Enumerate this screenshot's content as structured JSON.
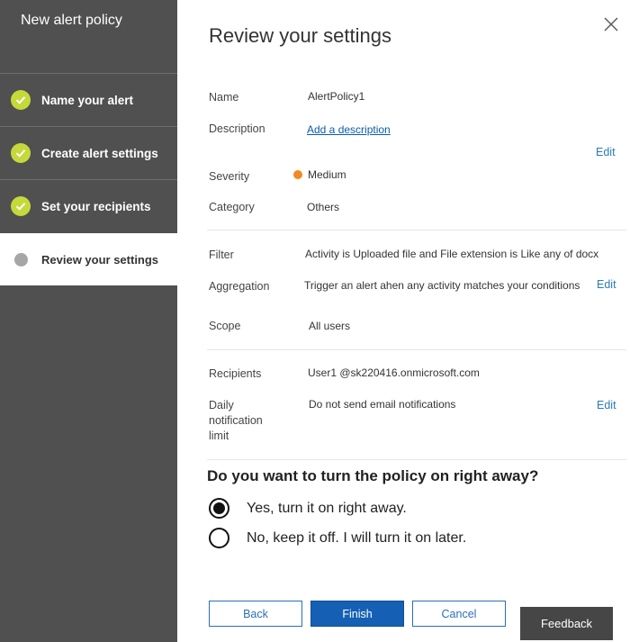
{
  "panel": {
    "title": "New alert policy"
  },
  "steps": [
    {
      "label": "Name your alert",
      "state": "complete"
    },
    {
      "label": "Create alert settings",
      "state": "complete"
    },
    {
      "label": "Set your recipients",
      "state": "complete"
    },
    {
      "label": "Review your settings",
      "state": "current"
    }
  ],
  "page": {
    "title": "Review your settings"
  },
  "general": {
    "name_label": "Name",
    "name_value": "AlertPolicy1",
    "description_label": "Description",
    "description_link": "Add a description",
    "severity_label": "Severity",
    "severity_value": "Medium",
    "severity_color": "#f08a24",
    "category_label": "Category",
    "category_value": "Others",
    "edit": "Edit"
  },
  "conditions": {
    "filter_label": "Filter",
    "filter_value": "Activity is Uploaded file and File extension is Like any of docx",
    "aggregation_label": "Aggregation",
    "aggregation_value": "Trigger an alert ahen any activity matches your conditions",
    "scope_label": "Scope",
    "scope_value": "All users",
    "edit": "Edit"
  },
  "recipients": {
    "recipients_label": "Recipients",
    "recipients_value": "User1 @sk220416.onmicrosoft.com",
    "limit_label_1": "Daily",
    "limit_label_2": "notification",
    "limit_label_3": "limit",
    "limit_value": "Do not send email notifications",
    "edit": "Edit"
  },
  "policy": {
    "question": "Do you want to turn the policy on right away?",
    "options": [
      {
        "label": "Yes, turn it on right away.",
        "selected": true
      },
      {
        "label": "No, keep it off. I will turn it on later.",
        "selected": false
      }
    ]
  },
  "buttons": {
    "back": "Back",
    "finish": "Finish",
    "cancel": "Cancel"
  },
  "feedback": {
    "label": "Feedback"
  },
  "icons": {
    "close": "close-icon",
    "check": "checkmark-icon"
  },
  "colors": {
    "step_complete": "#c5d93b",
    "primary": "#1560b4",
    "link": "#0b5cad"
  }
}
